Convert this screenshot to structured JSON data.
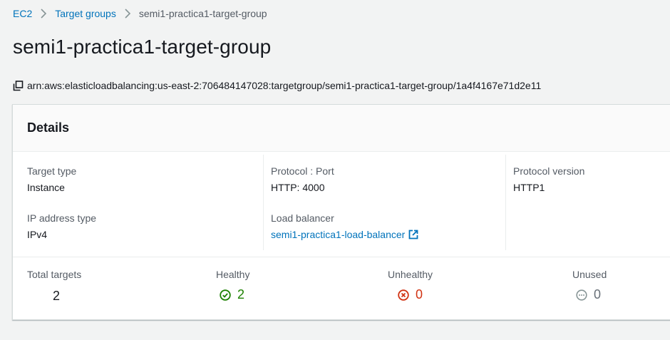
{
  "breadcrumb": {
    "items": [
      "EC2",
      "Target groups"
    ],
    "current": "semi1-practica1-target-group"
  },
  "page": {
    "title": "semi1-practica1-target-group",
    "arn": "arn:aws:elasticloadbalancing:us-east-2:706484147028:targetgroup/semi1-practica1-target-group/1a4f4167e71d2e11"
  },
  "details": {
    "title": "Details",
    "target_type_label": "Target type",
    "target_type_value": "Instance",
    "ip_type_label": "IP address type",
    "ip_type_value": "IPv4",
    "protocol_port_label": "Protocol : Port",
    "protocol_port_value": "HTTP: 4000",
    "load_balancer_label": "Load balancer",
    "load_balancer_value": "semi1-practica1-load-balancer",
    "protocol_version_label": "Protocol version",
    "protocol_version_value": "HTTP1"
  },
  "stats": {
    "total_label": "Total targets",
    "total_value": "2",
    "healthy_label": "Healthy",
    "healthy_value": "2",
    "unhealthy_label": "Unhealthy",
    "unhealthy_value": "0",
    "unused_label": "Unused",
    "unused_value": "0"
  },
  "colors": {
    "link": "#0073bb",
    "healthy": "#1d8102",
    "unhealthy": "#d13212",
    "unused": "#687078"
  },
  "icons": {
    "copy": "copy-icon",
    "external": "external-link-icon",
    "healthy": "status-positive-icon",
    "unhealthy": "status-negative-icon",
    "unused": "status-stopped-icon"
  }
}
